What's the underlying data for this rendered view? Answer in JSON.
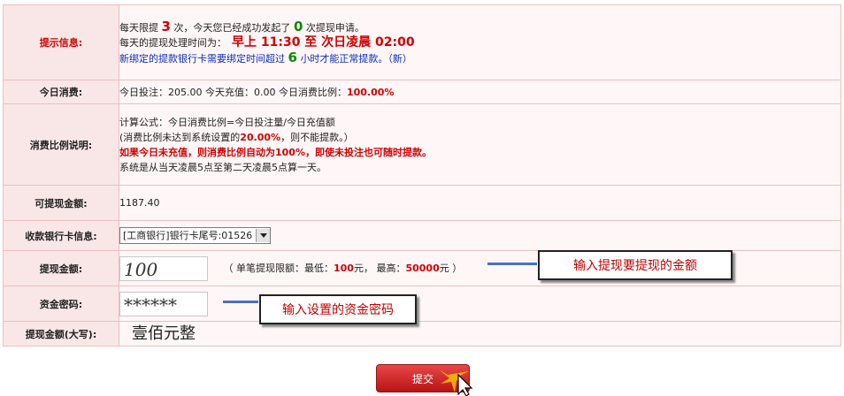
{
  "tip": {
    "label": "提示信息:",
    "line1": {
      "a": "每天限提",
      "limit": "3",
      "b": "次，今天您已经成功发起了",
      "count": "0",
      "c": "次提现申请。"
    },
    "line2": {
      "a": "每天的提现处理时间为：",
      "time": "早上 11:30 至 次日凌晨 02:00"
    },
    "line3": {
      "a": "新绑定的提款银行卡需要绑定时间超过",
      "hours": "6",
      "b": "小时才能正常提款。（新）"
    }
  },
  "consume": {
    "label": "今日消费:",
    "text": "今日投注：205.00 今天充值：0.00 今日消费比例：",
    "ratio": "100.00%"
  },
  "ratio_desc": {
    "label": "消费比例说明:",
    "line1": "计算公式：今日消费比例=今日投注量/今日充值额",
    "line2a": "(消费比例未达到系统设置的",
    "line2_pct": "20.00%",
    "line2b": "，则不能提款。）",
    "line3": "如果今日未充值，则消费比例自动为100%，即使未投注也可随时提款。",
    "line4": "系统是从当天凌晨5点至第二天凌晨5点算一天。"
  },
  "available": {
    "label": "可提现金额:",
    "value": "1187.40"
  },
  "bank": {
    "label": "收款银行卡信息:",
    "selected": "[工商银行]银行卡尾号:01526"
  },
  "amount": {
    "label": "提现金额:",
    "value": "100",
    "hint_a": "（ 单笔提现限额：最低：",
    "min": "100",
    "hint_b": "元，  最高：",
    "max": "50000",
    "hint_c": "元 ）",
    "callout": "输入提现要提现的金额"
  },
  "password": {
    "label": "资金密码:",
    "value": "******",
    "callout": "输入设置的资金密码"
  },
  "uppercase": {
    "label": "提现金额(大写):",
    "value": "壹佰元整"
  },
  "submit": {
    "label": "提交"
  }
}
